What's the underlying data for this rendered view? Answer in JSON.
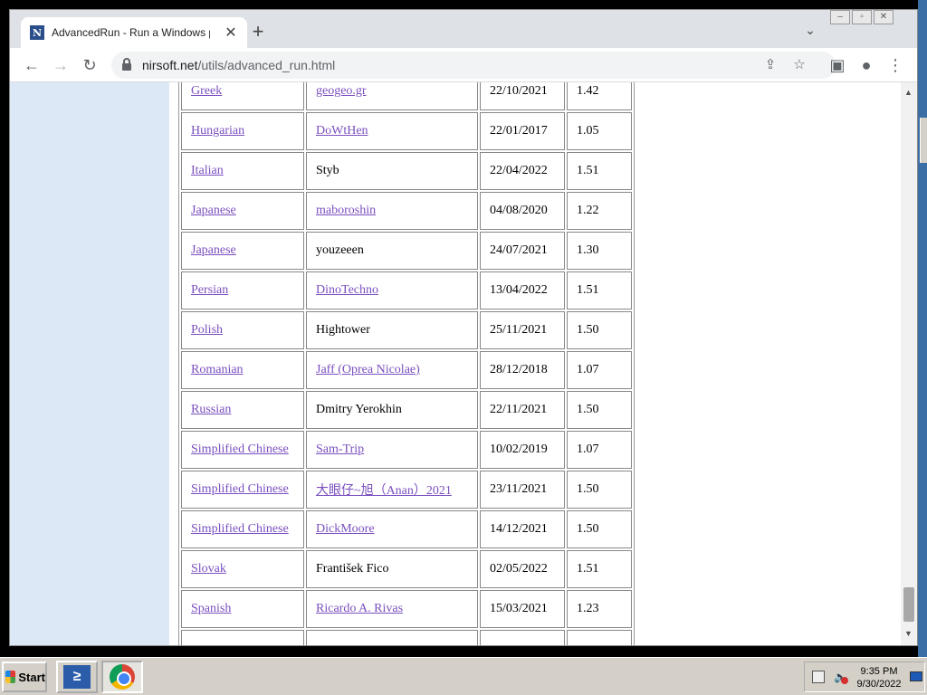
{
  "browser": {
    "tab_title": "AdvancedRun - Run a Windows pro",
    "favicon_letter": "N",
    "url_domain": "nirsoft.net",
    "url_path": "/utils/advanced_run.html",
    "close_glyph": "✕",
    "newtab_glyph": "+",
    "tab_menu_glyph": "⌄",
    "back_glyph": "←",
    "forward_glyph": "→",
    "reload_glyph": "↻",
    "share_glyph": "⇪",
    "star_glyph": "☆",
    "sidepanel_glyph": "▣",
    "profile_glyph": "●",
    "menu_glyph": "⋮"
  },
  "table": {
    "rows": [
      {
        "language": "Greek",
        "translator": "geogeo.gr",
        "translator_link": true,
        "date": "22/10/2021",
        "version": "1.42"
      },
      {
        "language": "Hungarian",
        "translator": "DoWtHen",
        "translator_link": true,
        "date": "22/01/2017",
        "version": "1.05"
      },
      {
        "language": "Italian",
        "translator": "Styb",
        "translator_link": false,
        "date": "22/04/2022",
        "version": "1.51"
      },
      {
        "language": "Japanese",
        "translator": "maboroshin",
        "translator_link": true,
        "date": "04/08/2020",
        "version": "1.22"
      },
      {
        "language": "Japanese",
        "translator": "youzeeen",
        "translator_link": false,
        "date": "24/07/2021",
        "version": "1.30"
      },
      {
        "language": "Persian",
        "translator": "DinoTechno",
        "translator_link": true,
        "date": "13/04/2022",
        "version": "1.51"
      },
      {
        "language": "Polish",
        "translator": "Hightower",
        "translator_link": false,
        "date": "25/11/2021",
        "version": "1.50"
      },
      {
        "language": "Romanian",
        "translator": "Jaff (Oprea Nicolae)",
        "translator_link": true,
        "date": "28/12/2018",
        "version": "1.07"
      },
      {
        "language": "Russian",
        "translator": "Dmitry Yerokhin",
        "translator_link": false,
        "date": "22/11/2021",
        "version": "1.50"
      },
      {
        "language": "Simplified Chinese",
        "translator": "Sam-Trip",
        "translator_link": true,
        "date": "10/02/2019",
        "version": "1.07"
      },
      {
        "language": "Simplified Chinese",
        "translator": "大眼仔~旭（Anan）2021",
        "translator_link": true,
        "date": "23/11/2021",
        "version": "1.50"
      },
      {
        "language": "Simplified Chinese",
        "translator": "DickMoore",
        "translator_link": true,
        "date": "14/12/2021",
        "version": "1.50"
      },
      {
        "language": "Slovak",
        "translator": "František Fico",
        "translator_link": false,
        "date": "02/05/2022",
        "version": "1.51"
      },
      {
        "language": "Spanish",
        "translator": "Ricardo A. Rivas",
        "translator_link": true,
        "date": "15/03/2021",
        "version": "1.23"
      }
    ]
  },
  "taskbar": {
    "start_label": "Start",
    "time": "9:35 PM",
    "date": "9/30/2022",
    "powershell_glyph": "≥"
  },
  "colors": {
    "link_visited": "#7a4fbf",
    "left_panel": "#dde8f7",
    "taskbar": "#d4d0c8"
  }
}
